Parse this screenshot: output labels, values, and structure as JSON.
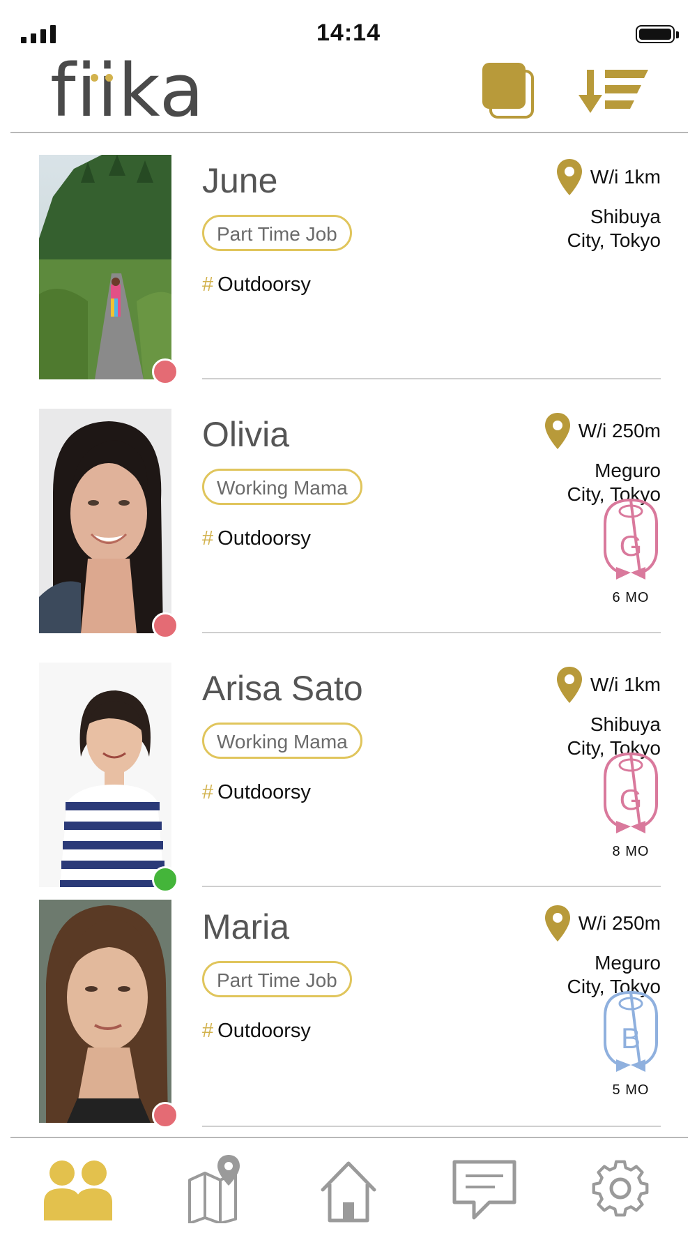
{
  "status_bar": {
    "time": "14:14"
  },
  "header": {
    "logo_text": "fiika",
    "logo_icon": "fiika-logo",
    "cards_icon": "stacked-cards-icon",
    "sort_icon": "sort-descending-icon"
  },
  "colors": {
    "accent": "#b89a3a",
    "gold_light": "#e0c55c",
    "offline": "#e46b74",
    "online": "#44b53a",
    "badge_pink": "#d9799c",
    "badge_blue": "#8fb0de",
    "inactive_icon": "#9a9a9a"
  },
  "profiles": [
    {
      "name": "June",
      "tag": "Part Time Job",
      "hashtag_symbol": "#",
      "hashtag": "Outdoorsy",
      "distance": "W/i 1km",
      "location_line1": "Shibuya",
      "location_line2": "City, Tokyo",
      "status": "offline"
    },
    {
      "name": "Olivia",
      "tag": "Working Mama",
      "hashtag_symbol": "#",
      "hashtag": "Outdoorsy",
      "distance": "W/i 250m",
      "location_line1": "Meguro",
      "location_line2": "City, Tokyo",
      "status": "offline",
      "badge_letter": "G",
      "badge_label": "6 MO",
      "badge_color": "#d9799c"
    },
    {
      "name": "Arisa Sato",
      "tag": "Working Mama",
      "hashtag_symbol": "#",
      "hashtag": "Outdoorsy",
      "distance": "W/i 1km",
      "location_line1": "Shibuya",
      "location_line2": "City, Tokyo",
      "status": "online",
      "badge_letter": "G",
      "badge_label": "8 MO",
      "badge_color": "#d9799c"
    },
    {
      "name": "Maria",
      "tag": "Part Time Job",
      "hashtag_symbol": "#",
      "hashtag": "Outdoorsy",
      "distance": "W/i 250m",
      "location_line1": "Meguro",
      "location_line2": "City, Tokyo",
      "status": "offline",
      "badge_letter": "B",
      "badge_label": "5 MO",
      "badge_color": "#8fb0de"
    }
  ],
  "tab_bar": {
    "tabs": [
      {
        "icon": "people-icon",
        "active": true
      },
      {
        "icon": "map-pin-icon",
        "active": false
      },
      {
        "icon": "home-icon",
        "active": false
      },
      {
        "icon": "chat-icon",
        "active": false
      },
      {
        "icon": "settings-gear-icon",
        "active": false
      }
    ]
  }
}
